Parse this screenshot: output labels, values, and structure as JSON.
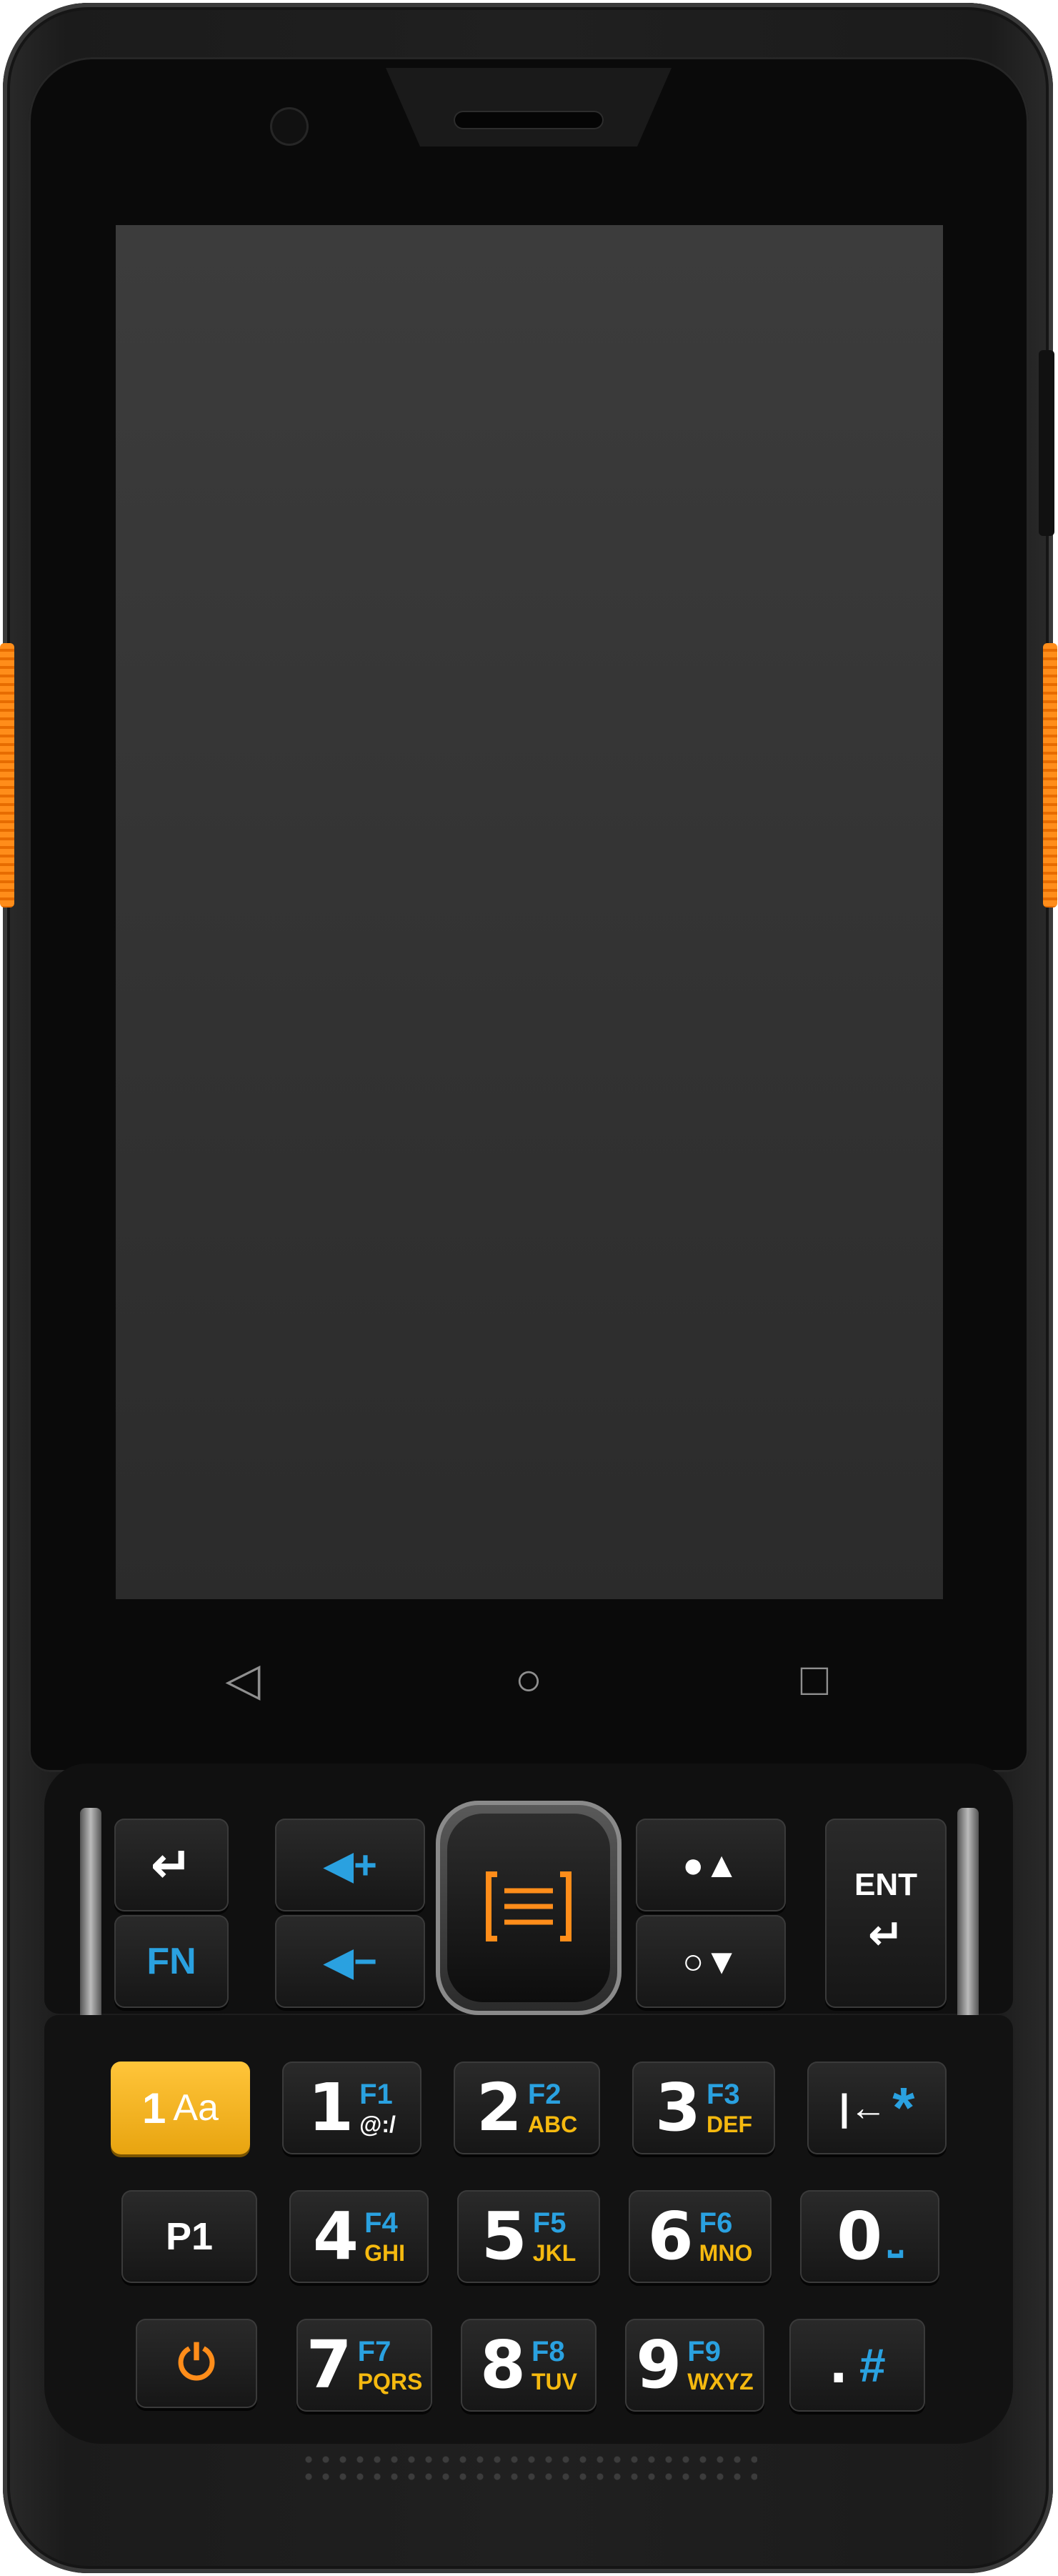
{
  "device": {
    "nav_buttons": [
      {
        "icon": "back-triangle-icon",
        "glyph": "◁"
      },
      {
        "icon": "home-circle-icon",
        "glyph": "○"
      },
      {
        "icon": "recents-square-icon",
        "glyph": "□"
      }
    ],
    "colors": {
      "accent_orange": "#ff8d1a",
      "fn_blue": "#2aa1e0",
      "alpha_yellow": "#f5b90f",
      "yellow_key": "#f4b41a"
    }
  },
  "keys": {
    "back": {
      "icon": "back-arrow-icon",
      "glyph": "↵"
    },
    "fn": {
      "label": "FN"
    },
    "ent": {
      "label": "ENT",
      "glyph": "↵"
    },
    "vol_up": {
      "glyph": "◀+"
    },
    "vol_down": {
      "glyph": "◀−"
    },
    "bright_up": {
      "glyph": "●▲"
    },
    "bright_down": {
      "glyph": "○▼"
    },
    "alpha": {
      "num": "1",
      "label": "Aa"
    },
    "p1": {
      "label": "P1"
    },
    "power": {
      "icon": "power-icon",
      "glyph": "⏻"
    },
    "k1": {
      "num": "1",
      "fn": "F1",
      "alpha": "@:/"
    },
    "k2": {
      "num": "2",
      "fn": "F2",
      "alpha": "ABC"
    },
    "k3": {
      "num": "3",
      "fn": "F3",
      "alpha": "DEF"
    },
    "k4": {
      "num": "4",
      "fn": "F4",
      "alpha": "GHI"
    },
    "k5": {
      "num": "5",
      "fn": "F5",
      "alpha": "JKL"
    },
    "k6": {
      "num": "6",
      "fn": "F6",
      "alpha": "MNO"
    },
    "k7": {
      "num": "7",
      "fn": "F7",
      "alpha": "PQRS"
    },
    "k8": {
      "num": "8",
      "fn": "F8",
      "alpha": "TUV"
    },
    "k9": {
      "num": "9",
      "fn": "F9",
      "alpha": "WXYZ"
    },
    "k0": {
      "num": "0",
      "glyph": "⎵"
    },
    "kstar": {
      "glyph": "|←",
      "sym": "*"
    },
    "kdot": {
      "num": ".",
      "sym": "#"
    }
  }
}
